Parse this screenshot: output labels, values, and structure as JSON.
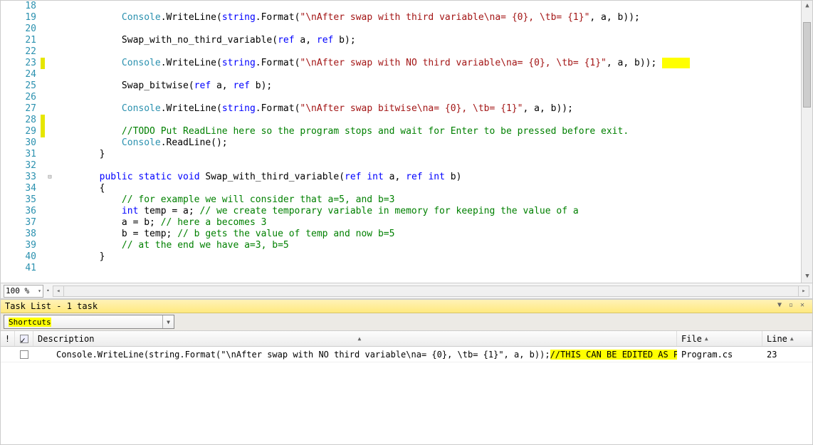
{
  "zoom": "100 %",
  "code": {
    "lines": [
      {
        "n": 18,
        "mod": false,
        "fold": "",
        "tokens": []
      },
      {
        "n": 19,
        "mod": false,
        "fold": "",
        "tokens": [
          {
            "t": "            ",
            "c": ""
          },
          {
            "t": "Console",
            "c": "t"
          },
          {
            "t": ".WriteLine(",
            "c": ""
          },
          {
            "t": "string",
            "c": "k"
          },
          {
            "t": ".Format(",
            "c": ""
          },
          {
            "t": "\"\\nAfter swap with third variable\\na= {0}, \\tb= {1}\"",
            "c": "s"
          },
          {
            "t": ", a, b));",
            "c": ""
          }
        ]
      },
      {
        "n": 20,
        "mod": false,
        "fold": "",
        "tokens": []
      },
      {
        "n": 21,
        "mod": false,
        "fold": "",
        "tokens": [
          {
            "t": "            Swap_with_no_third_variable(",
            "c": ""
          },
          {
            "t": "ref",
            "c": "k"
          },
          {
            "t": " a, ",
            "c": ""
          },
          {
            "t": "ref",
            "c": "k"
          },
          {
            "t": " b);",
            "c": ""
          }
        ]
      },
      {
        "n": 22,
        "mod": false,
        "fold": "",
        "tokens": []
      },
      {
        "n": 23,
        "mod": true,
        "fold": "",
        "tokens": [
          {
            "t": "            ",
            "c": ""
          },
          {
            "t": "Console",
            "c": "t"
          },
          {
            "t": ".WriteLine(",
            "c": ""
          },
          {
            "t": "string",
            "c": "k"
          },
          {
            "t": ".Format(",
            "c": ""
          },
          {
            "t": "\"\\nAfter swap with NO third variable\\na= {0}, \\tb= {1}\"",
            "c": "s"
          },
          {
            "t": ", a, b)); ",
            "c": ""
          },
          {
            "t": "     ",
            "c": "hl"
          }
        ]
      },
      {
        "n": 24,
        "mod": false,
        "fold": "",
        "tokens": []
      },
      {
        "n": 25,
        "mod": false,
        "fold": "",
        "tokens": [
          {
            "t": "            Swap_bitwise(",
            "c": ""
          },
          {
            "t": "ref",
            "c": "k"
          },
          {
            "t": " a, ",
            "c": ""
          },
          {
            "t": "ref",
            "c": "k"
          },
          {
            "t": " b);",
            "c": ""
          }
        ]
      },
      {
        "n": 26,
        "mod": false,
        "fold": "",
        "tokens": []
      },
      {
        "n": 27,
        "mod": false,
        "fold": "",
        "tokens": [
          {
            "t": "            ",
            "c": ""
          },
          {
            "t": "Console",
            "c": "t"
          },
          {
            "t": ".WriteLine(",
            "c": ""
          },
          {
            "t": "string",
            "c": "k"
          },
          {
            "t": ".Format(",
            "c": ""
          },
          {
            "t": "\"\\nAfter swap bitwise\\na= {0}, \\tb= {1}\"",
            "c": "s"
          },
          {
            "t": ", a, b));",
            "c": ""
          }
        ]
      },
      {
        "n": 28,
        "mod": true,
        "fold": "",
        "tokens": []
      },
      {
        "n": 29,
        "mod": true,
        "fold": "",
        "tokens": [
          {
            "t": "            ",
            "c": ""
          },
          {
            "t": "//TODO Put ReadLine here so the program stops and wait for Enter to be pressed before exit.",
            "c": "c"
          }
        ]
      },
      {
        "n": 30,
        "mod": false,
        "fold": "",
        "tokens": [
          {
            "t": "            ",
            "c": ""
          },
          {
            "t": "Console",
            "c": "t"
          },
          {
            "t": ".ReadLine();",
            "c": ""
          }
        ]
      },
      {
        "n": 31,
        "mod": false,
        "fold": "",
        "tokens": [
          {
            "t": "        }",
            "c": ""
          }
        ]
      },
      {
        "n": 32,
        "mod": false,
        "fold": "",
        "tokens": []
      },
      {
        "n": 33,
        "mod": false,
        "fold": "⊟",
        "tokens": [
          {
            "t": "        ",
            "c": ""
          },
          {
            "t": "public",
            "c": "k"
          },
          {
            "t": " ",
            "c": ""
          },
          {
            "t": "static",
            "c": "k"
          },
          {
            "t": " ",
            "c": ""
          },
          {
            "t": "void",
            "c": "k"
          },
          {
            "t": " Swap_with_third_variable(",
            "c": ""
          },
          {
            "t": "ref",
            "c": "k"
          },
          {
            "t": " ",
            "c": ""
          },
          {
            "t": "int",
            "c": "k"
          },
          {
            "t": " a, ",
            "c": ""
          },
          {
            "t": "ref",
            "c": "k"
          },
          {
            "t": " ",
            "c": ""
          },
          {
            "t": "int",
            "c": "k"
          },
          {
            "t": " b)",
            "c": ""
          }
        ]
      },
      {
        "n": 34,
        "mod": false,
        "fold": "",
        "tokens": [
          {
            "t": "        {",
            "c": ""
          }
        ]
      },
      {
        "n": 35,
        "mod": false,
        "fold": "",
        "tokens": [
          {
            "t": "            ",
            "c": ""
          },
          {
            "t": "// for example we will consider that a=5, and b=3",
            "c": "c"
          }
        ]
      },
      {
        "n": 36,
        "mod": false,
        "fold": "",
        "tokens": [
          {
            "t": "            ",
            "c": ""
          },
          {
            "t": "int",
            "c": "k"
          },
          {
            "t": " temp = a; ",
            "c": ""
          },
          {
            "t": "// we create temporary variable in memory for keeping the value of a",
            "c": "c"
          }
        ]
      },
      {
        "n": 37,
        "mod": false,
        "fold": "",
        "tokens": [
          {
            "t": "            a = b; ",
            "c": ""
          },
          {
            "t": "// here a becomes 3",
            "c": "c"
          }
        ]
      },
      {
        "n": 38,
        "mod": false,
        "fold": "",
        "tokens": [
          {
            "t": "            b = temp; ",
            "c": ""
          },
          {
            "t": "// b gets the value of temp and now b=5",
            "c": "c"
          }
        ]
      },
      {
        "n": 39,
        "mod": false,
        "fold": "",
        "tokens": [
          {
            "t": "            ",
            "c": ""
          },
          {
            "t": "// at the end we have a=3, b=5",
            "c": "c"
          }
        ]
      },
      {
        "n": 40,
        "mod": false,
        "fold": "",
        "tokens": [
          {
            "t": "        }",
            "c": ""
          }
        ]
      },
      {
        "n": 41,
        "mod": false,
        "fold": "",
        "tokens": []
      }
    ]
  },
  "tasklist": {
    "title": "Task List - 1 task",
    "filter": "Shortcuts",
    "headers": {
      "description": "Description",
      "file": "File",
      "line": "Line"
    },
    "rows": [
      {
        "checked": false,
        "desc_plain": "Console.WriteLine(string.Format(\"\\nAfter swap with NO third variable\\na= {0}, \\tb= {1}\", a, b)); ",
        "desc_hl": "//THIS CAN BE EDITED AS PER OUR NEEDS",
        "file": "Program.cs",
        "line": "23"
      }
    ]
  }
}
